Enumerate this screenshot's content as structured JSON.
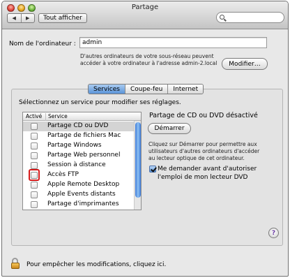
{
  "window": {
    "title": "Partage"
  },
  "toolbar": {
    "back_glyph": "◀",
    "forward_glyph": "▶",
    "show_all_label": "Tout afficher",
    "search_placeholder": ""
  },
  "computer": {
    "name_label": "Nom de l'ordinateur :",
    "name_value": "admin",
    "note_line1": "D'autres ordinateurs de votre sous-réseau peuvent",
    "note_line2": "accéder à votre ordinateur à l'adresse admin-2.local",
    "edit_button": "Modifier…"
  },
  "tabs": [
    {
      "label": "Services",
      "active": true
    },
    {
      "label": "Coupe-feu",
      "active": false
    },
    {
      "label": "Internet",
      "active": false
    }
  ],
  "services_panel": {
    "instruction": "Sélectionnez un service pour modifier ses réglages.",
    "columns": [
      "Activé",
      "Service"
    ],
    "rows": [
      {
        "name": "Partage CD ou DVD",
        "enabled": false,
        "selected": true
      },
      {
        "name": "Partage de fichiers Mac",
        "enabled": false
      },
      {
        "name": "Partage Windows",
        "enabled": false
      },
      {
        "name": "Partage Web personnel",
        "enabled": false
      },
      {
        "name": "Session à distance",
        "enabled": false
      },
      {
        "name": "Accès FTP",
        "enabled": false,
        "highlighted": true
      },
      {
        "name": "Apple Remote Desktop",
        "enabled": false
      },
      {
        "name": "Apple Events distants",
        "enabled": false
      },
      {
        "name": "Partage d'imprimantes",
        "enabled": false
      }
    ]
  },
  "detail": {
    "status": "Partage de CD ou DVD désactivé",
    "start_button": "Démarrer",
    "help_line1": "Cliquez sur Démarrer pour permettre aux",
    "help_line2": "utilisateurs d'autres ordinateurs d'accéder",
    "help_line3": "au lecteur optique de cet ordinateur.",
    "ask_line1": "Me demander avant d'autoriser",
    "ask_line2": "l'emploi de mon lecteur DVD",
    "ask_checked": true,
    "help_glyph": "?"
  },
  "footer": {
    "lock_text": "Pour empêcher les modifications, cliquez ici."
  },
  "colors": {
    "selection_blue": "#5a94d8",
    "highlight_red": "#d51a1a"
  }
}
